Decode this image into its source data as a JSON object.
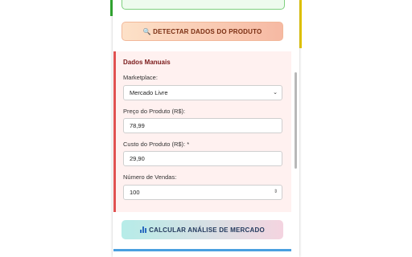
{
  "detect_button": {
    "icon": "magnifier-icon",
    "label": "🔍 DETECTAR DADOS DO PRODUTO"
  },
  "manual": {
    "title": "Dados Manuais",
    "marketplace": {
      "label": "Marketplace:",
      "value": "Mercado Livre"
    },
    "price": {
      "label": "Preço do Produto (R$):",
      "value": "78,99"
    },
    "cost": {
      "label": "Custo do Produto (R$): *",
      "value": "29,90"
    },
    "sales": {
      "label": "Número de Vendas:",
      "value": "100"
    }
  },
  "calc_button": {
    "icon": "bar-chart-icon",
    "label": "CALCULAR ANÁLISE DE MERCADO"
  },
  "colors": {
    "accent_red": "#e05151",
    "detect_text": "#7a2e12",
    "calc_text": "#243a5e"
  }
}
